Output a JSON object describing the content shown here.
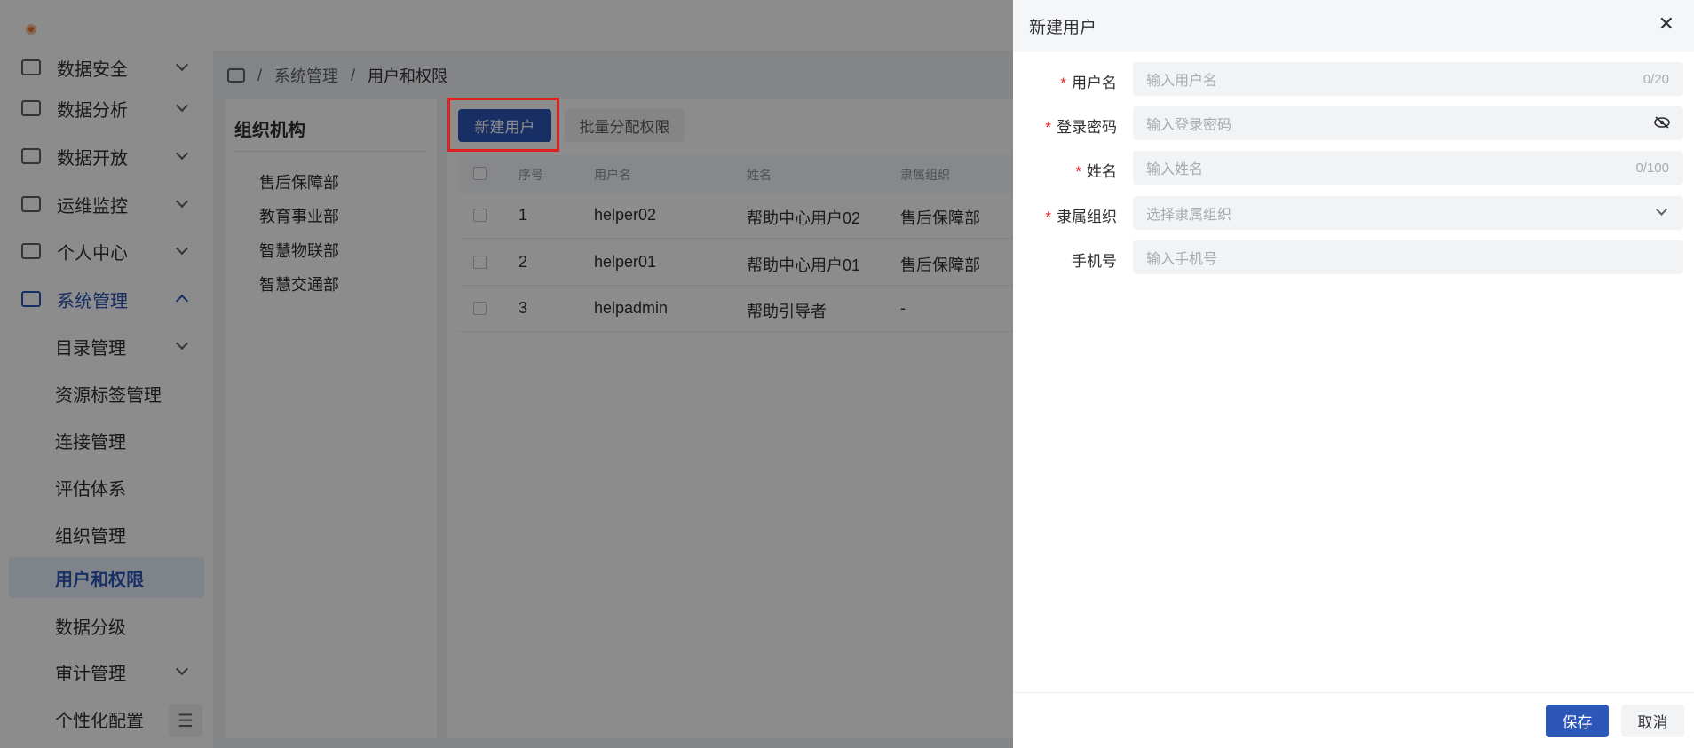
{
  "sidebar": {
    "items": [
      {
        "label": "数据安全",
        "icon": "shield-check-icon"
      },
      {
        "label": "数据分析",
        "icon": "analysis-icon"
      },
      {
        "label": "数据开放",
        "icon": "open-data-icon"
      },
      {
        "label": "运维监控",
        "icon": "monitor-chart-icon"
      },
      {
        "label": "个人中心",
        "icon": "user-card-icon"
      },
      {
        "label": "系统管理",
        "icon": "system-icon"
      }
    ],
    "subitems": [
      {
        "label": "目录管理"
      },
      {
        "label": "资源标签管理"
      },
      {
        "label": "连接管理"
      },
      {
        "label": "评估体系"
      },
      {
        "label": "组织管理"
      },
      {
        "label": "用户和权限"
      },
      {
        "label": "数据分级"
      },
      {
        "label": "审计管理"
      },
      {
        "label": "个性化配置"
      }
    ]
  },
  "breadcrumb": {
    "level1": "系统管理",
    "level2": "用户和权限",
    "separator": "/"
  },
  "org": {
    "title": "组织机构",
    "items": [
      "售后保障部",
      "教育事业部",
      "智慧物联部",
      "智慧交通部"
    ]
  },
  "toolbar": {
    "new_user": "新建用户",
    "batch_assign": "批量分配权限"
  },
  "table": {
    "headers": {
      "index": "序号",
      "username": "用户名",
      "name": "姓名",
      "org": "隶属组织"
    },
    "rows": [
      {
        "index": "1",
        "username": "helper02",
        "name": "帮助中心用户02",
        "org": "售后保障部"
      },
      {
        "index": "2",
        "username": "helper01",
        "name": "帮助中心用户01",
        "org": "售后保障部"
      },
      {
        "index": "3",
        "username": "helpadmin",
        "name": "帮助引导者",
        "org": "-"
      }
    ]
  },
  "drawer": {
    "title": "新建用户",
    "close": "✕",
    "required_mark": "*",
    "fields": {
      "username": {
        "label": "用户名",
        "placeholder": "输入用户名",
        "count": "0/20"
      },
      "password": {
        "label": "登录密码",
        "placeholder": "输入登录密码"
      },
      "name": {
        "label": "姓名",
        "placeholder": "输入姓名",
        "count": "0/100"
      },
      "org": {
        "label": "隶属组织",
        "placeholder": "选择隶属组织"
      },
      "phone": {
        "label": "手机号",
        "placeholder": "输入手机号"
      }
    },
    "save": "保存",
    "cancel": "取消"
  },
  "colors": {
    "primary": "#2c56b8",
    "highlight": "#e02020",
    "required": "#e02020"
  }
}
